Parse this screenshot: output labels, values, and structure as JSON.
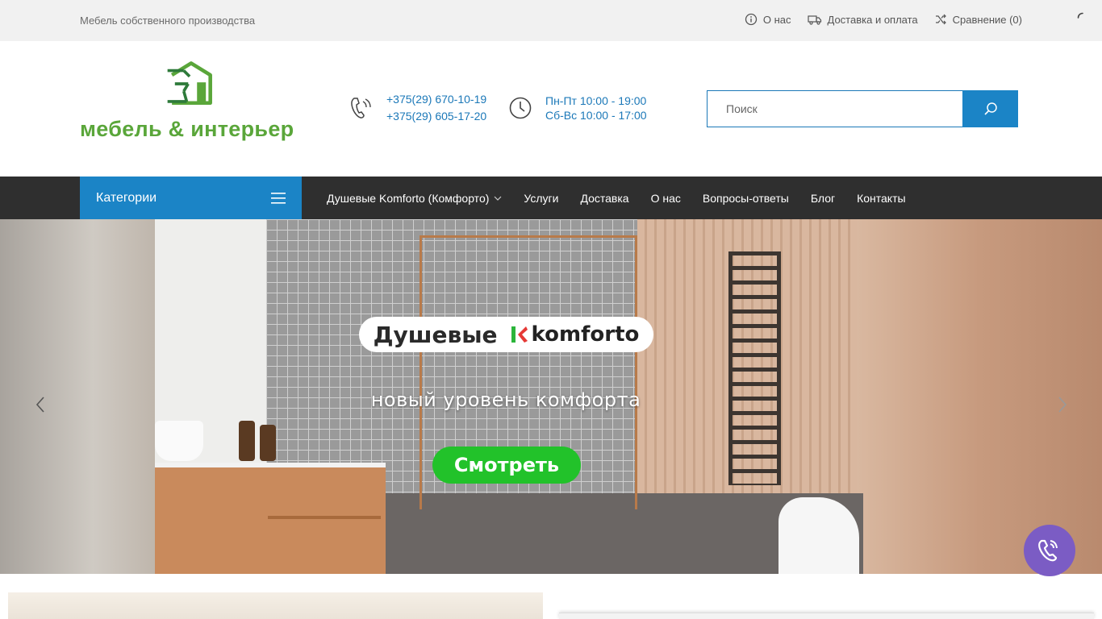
{
  "topbar": {
    "tagline": "Мебель собственного производства",
    "links": {
      "about": "О нас",
      "delivery": "Доставка и оплата",
      "compare": "Сравнение (0)"
    }
  },
  "header": {
    "logo_text": "мебель & интерьер",
    "phones": [
      "+375(29) 670-10-19",
      "+375(29) 605-17-20"
    ],
    "hours": [
      "Пн-Пт 10:00 - 19:00",
      "Сб-Вс 10:00 - 17:00"
    ],
    "search_placeholder": "Поиск"
  },
  "nav": {
    "categories_label": "Категории",
    "items": [
      "Душевые Komforto (Комфорто)",
      "Услуги",
      "Доставка",
      "О нас",
      "Вопросы-ответы",
      "Блог",
      "Контакты"
    ]
  },
  "hero": {
    "badge_text": "Душевые",
    "brand_name": "komforto",
    "tagline": "новый уровень комфорта",
    "cta_label": "Смотреть"
  },
  "colors": {
    "accent_blue": "#1b84c6",
    "nav_dark": "#2f2f2f",
    "logo_green": "#5aa63a",
    "cta_green": "#22c22a",
    "viber_purple": "#7b5cc4"
  },
  "icons": {
    "about": "info-icon",
    "delivery": "truck-icon",
    "compare": "shuffle-icon",
    "phone": "phone-icon",
    "hours": "clock-icon",
    "search": "search-icon",
    "categories": "menu-icon",
    "viber": "viber-phone-icon"
  }
}
